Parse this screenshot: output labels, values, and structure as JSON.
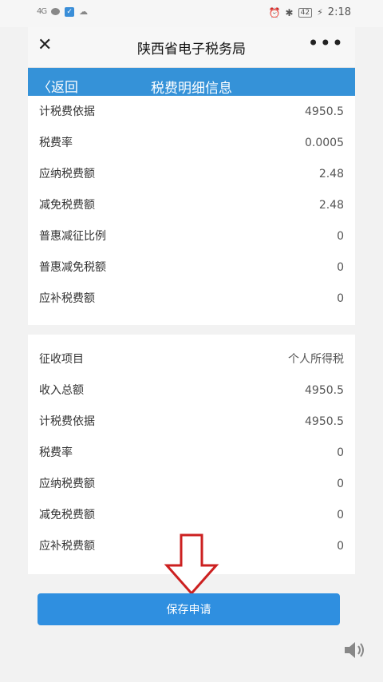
{
  "status_bar": {
    "signal": "4G",
    "time": "2:18",
    "battery": "42"
  },
  "header": {
    "title": "陕西省电子税务局",
    "more_label": "•••",
    "close_label": "✕"
  },
  "subheader": {
    "back_label": "〈返回",
    "title": "税费明细信息"
  },
  "section1": {
    "rows": [
      {
        "label": "计税费依据",
        "value": "4950.5"
      },
      {
        "label": "税费率",
        "value": "0.0005"
      },
      {
        "label": "应纳税费额",
        "value": "2.48"
      },
      {
        "label": "减免税费额",
        "value": "2.48"
      },
      {
        "label": "普惠减征比例",
        "value": "0"
      },
      {
        "label": "普惠减免税额",
        "value": "0"
      },
      {
        "label": "应补税费额",
        "value": "0"
      }
    ]
  },
  "section2": {
    "rows": [
      {
        "label": "征收项目",
        "value": "个人所得税"
      },
      {
        "label": "收入总额",
        "value": "4950.5"
      },
      {
        "label": "计税费依据",
        "value": "4950.5"
      },
      {
        "label": "税费率",
        "value": "0"
      },
      {
        "label": "应纳税费额",
        "value": "0"
      },
      {
        "label": "减免税费额",
        "value": "0"
      },
      {
        "label": "应补税费额",
        "value": "0"
      }
    ]
  },
  "actions": {
    "save_label": "保存申请"
  },
  "colors": {
    "accent": "#3592d8",
    "button": "#2f8fe0",
    "annotation_arrow": "#cc2020"
  }
}
